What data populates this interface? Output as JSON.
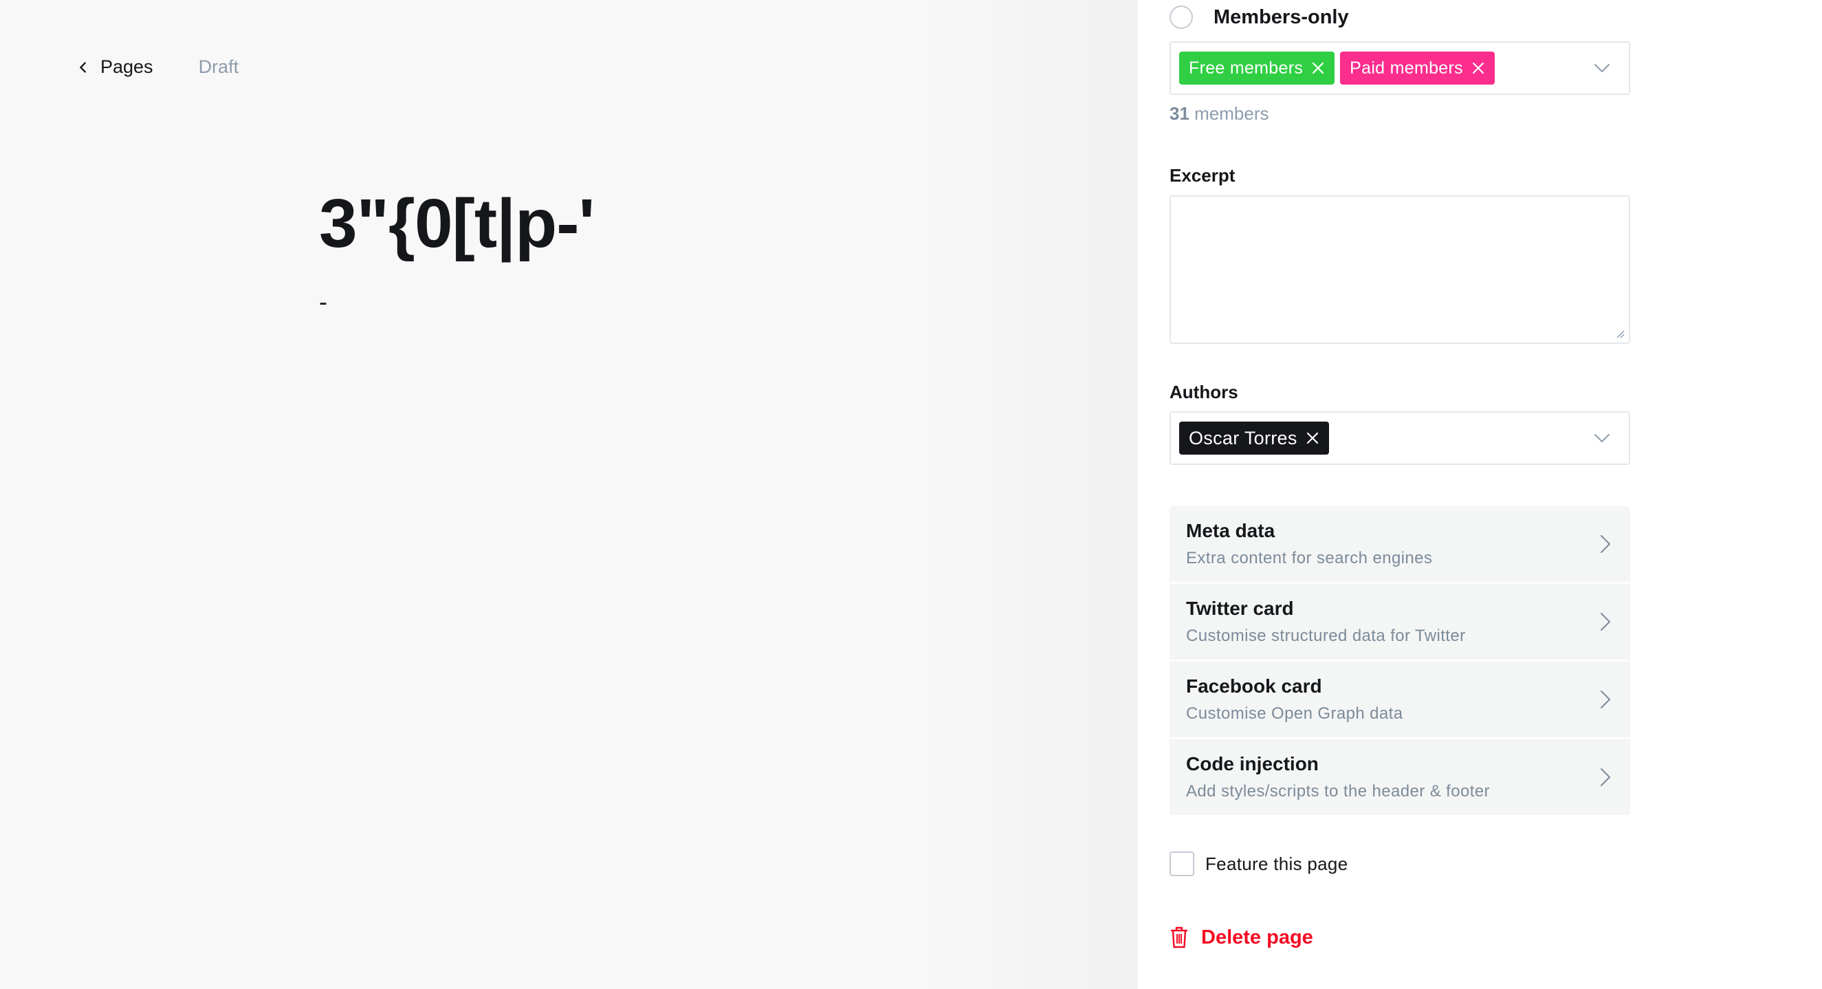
{
  "header": {
    "back_label": "Pages",
    "status": "Draft"
  },
  "editor": {
    "title": "3\"{0[t|p-'",
    "body": "-"
  },
  "settings": {
    "visibility_label": "Members-only",
    "tags": [
      "Free members",
      "Paid members"
    ],
    "member_count_number": "31",
    "member_count_suffix": " members",
    "excerpt_label": "Excerpt",
    "excerpt_value": "",
    "authors_label": "Authors",
    "authors": [
      "Oscar Torres"
    ],
    "nav_items": [
      {
        "title": "Meta data",
        "desc": "Extra content for search engines"
      },
      {
        "title": "Twitter card",
        "desc": "Customise structured data for Twitter"
      },
      {
        "title": "Facebook card",
        "desc": "Customise Open Graph data"
      },
      {
        "title": "Code injection",
        "desc": "Add styles/scripts to the header & footer"
      }
    ],
    "feature_label": "Feature this page",
    "feature_checked": false,
    "delete_label": "Delete page"
  },
  "colors": {
    "free_tag": "#30cf43",
    "paid_tag": "#fb2d8d",
    "author_tag": "#15171a",
    "danger": "#f50b23"
  },
  "icons": {
    "back": "chevron-left-icon",
    "dropdown": "chevron-down-icon",
    "remove": "close-icon",
    "expand": "chevron-right-icon",
    "delete": "trash-icon"
  }
}
